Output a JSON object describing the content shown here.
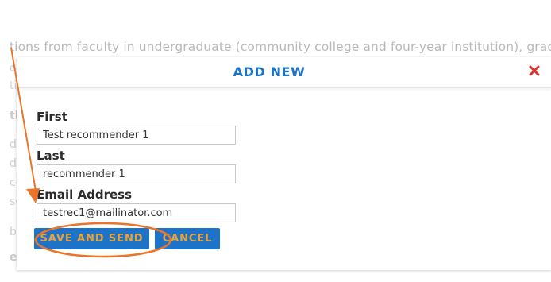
{
  "background": {
    "text_line": "tions from faculty in undergraduate (community college and four-year institution), grad",
    "fragments": [
      "or",
      "ti",
      "th",
      "d",
      "d",
      "cc",
      "sc",
      "b",
      "es",
      "u"
    ]
  },
  "modal": {
    "title": "ADD NEW",
    "close_symbol": "×",
    "fields": {
      "first": {
        "label": "First",
        "value": "Test recommender 1"
      },
      "last": {
        "label": "Last",
        "value": "recommender 1"
      },
      "email": {
        "label": "Email Address",
        "value": "testrec1@mailinator.com"
      }
    },
    "buttons": {
      "save_and_send": "SAVE AND SEND",
      "cancel": "CANCEL"
    }
  },
  "colors": {
    "accent_blue": "#1c73c8",
    "button_text_orange": "#e8a23a",
    "close_red": "#d9342b",
    "annotation_orange": "#e9742b"
  }
}
